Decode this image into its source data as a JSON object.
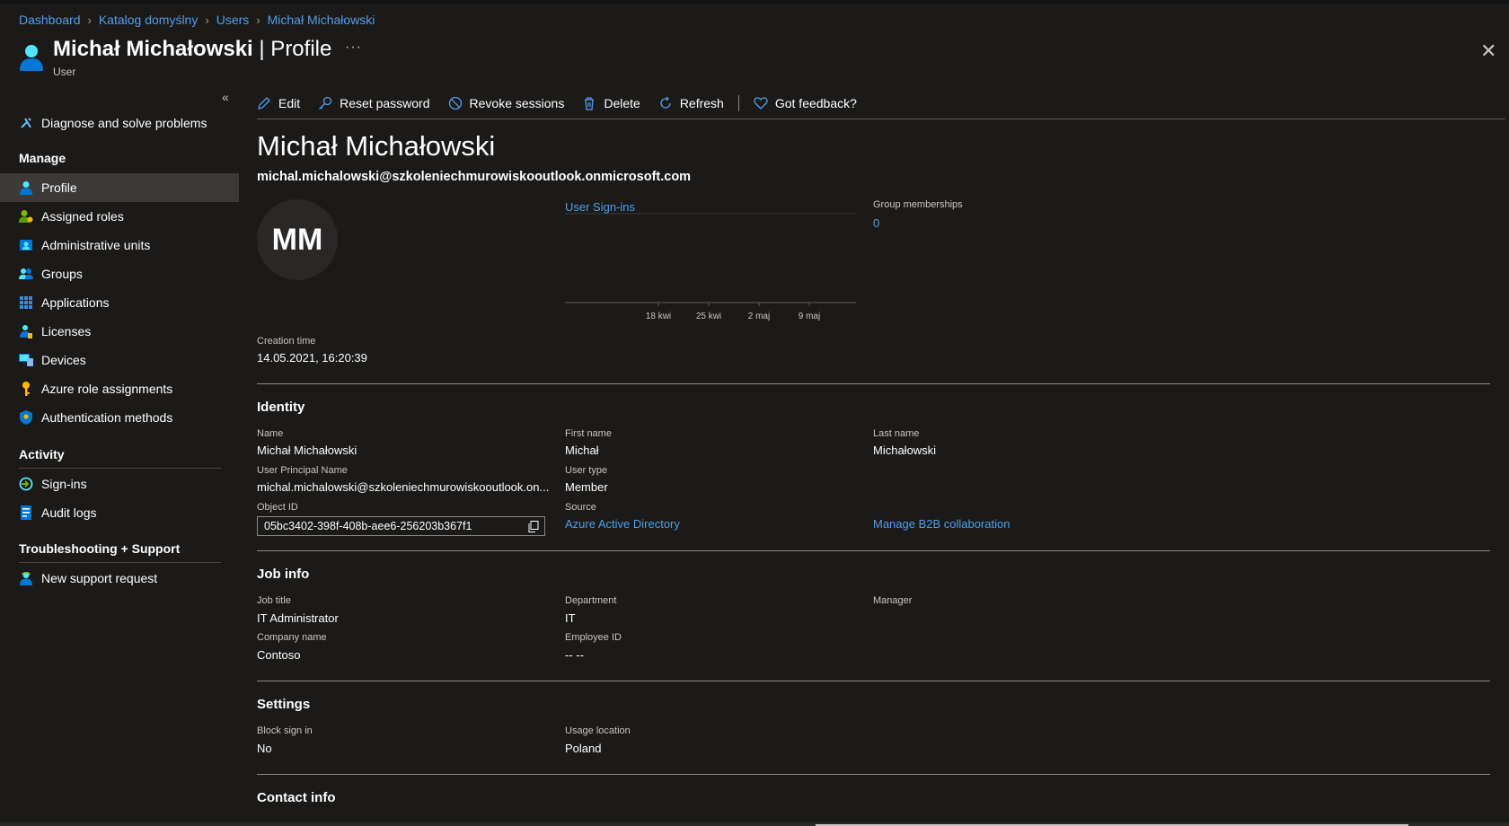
{
  "breadcrumb": [
    "Dashboard",
    "Katalog domyślny",
    "Users",
    "Michał Michałowski"
  ],
  "header": {
    "name": "Michał Michałowski",
    "title_suffix": " | Profile",
    "subtitle": "User",
    "more_label": "···",
    "close_label": "✕"
  },
  "sidebar": {
    "collapse_label": "«",
    "top_item": "Diagnose and solve problems",
    "manage_title": "Manage",
    "manage_items": [
      "Profile",
      "Assigned roles",
      "Administrative units",
      "Groups",
      "Applications",
      "Licenses",
      "Devices",
      "Azure role assignments",
      "Authentication methods"
    ],
    "activity_title": "Activity",
    "activity_items": [
      "Sign-ins",
      "Audit logs"
    ],
    "support_title": "Troubleshooting + Support",
    "support_items": [
      "New support request"
    ]
  },
  "toolbar": {
    "edit": "Edit",
    "reset_password": "Reset password",
    "revoke_sessions": "Revoke sessions",
    "delete": "Delete",
    "refresh": "Refresh",
    "feedback": "Got feedback?"
  },
  "profile": {
    "display_name": "Michał Michałowski",
    "upn": "michal.michalowski@szkoleniechmurowiskooutlook.onmicrosoft.com",
    "initials": "MM",
    "signins_title": "User Sign-ins",
    "group_memberships_label": "Group memberships",
    "group_memberships_value": "0",
    "creation_time_label": "Creation time",
    "creation_time_value": "14.05.2021, 16:20:39"
  },
  "chart_data": {
    "type": "line",
    "title": "User Sign-ins",
    "x_ticks": [
      "18 kwi",
      "25 kwi",
      "2 maj",
      "9 maj"
    ],
    "series": []
  },
  "identity": {
    "title": "Identity",
    "name_label": "Name",
    "name_value": "Michał Michałowski",
    "first_name_label": "First name",
    "first_name_value": "Michał",
    "last_name_label": "Last name",
    "last_name_value": "Michałowski",
    "upn_label": "User Principal Name",
    "upn_value": "michal.michalowski@szkoleniechmurowiskooutlook.on...",
    "user_type_label": "User type",
    "user_type_value": "Member",
    "object_id_label": "Object ID",
    "object_id_value": "05bc3402-398f-408b-aee6-256203b367f1",
    "source_label": "Source",
    "source_value": "Azure Active Directory",
    "b2b_link": "Manage B2B collaboration"
  },
  "job": {
    "title": "Job info",
    "job_title_label": "Job title",
    "job_title_value": "IT Administrator",
    "department_label": "Department",
    "department_value": "IT",
    "manager_label": "Manager",
    "company_label": "Company name",
    "company_value": "Contoso",
    "employee_id_label": "Employee ID",
    "employee_id_value": "-- --"
  },
  "settings": {
    "title": "Settings",
    "block_label": "Block sign in",
    "block_value": "No",
    "usage_label": "Usage location",
    "usage_value": "Poland"
  },
  "contact": {
    "title": "Contact info"
  },
  "colors": {
    "background": "#1b1a19",
    "link": "#4f9fea",
    "active_nav": "#3b3a39",
    "muted_text": "#c8c6c4"
  }
}
